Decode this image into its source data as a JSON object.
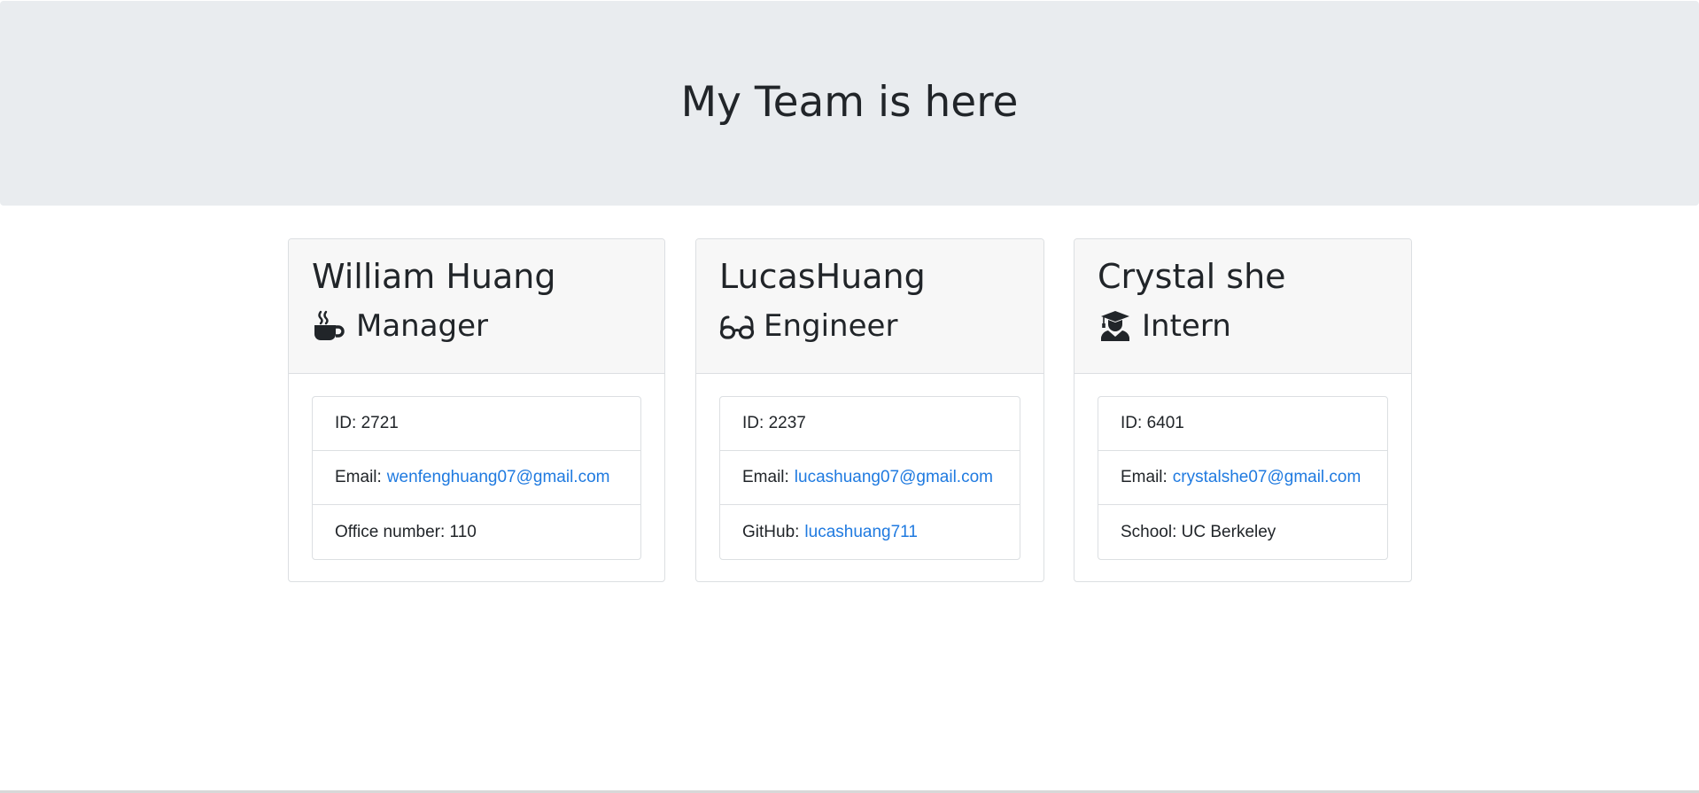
{
  "header": {
    "title": "My Team is here"
  },
  "employees": [
    {
      "name": "William Huang",
      "role": "Manager",
      "role_icon": "coffee-icon",
      "id_label": "ID:",
      "id": "2721",
      "email_label": "Email:",
      "email": "wenfenghuang07@gmail.com",
      "extra_label": "Office number:",
      "extra_value": "110"
    },
    {
      "name": "LucasHuang",
      "role": "Engineer",
      "role_icon": "glasses-icon",
      "id_label": "ID:",
      "id": "2237",
      "email_label": "Email:",
      "email": "lucashuang07@gmail.com",
      "extra_label": "GitHub:",
      "extra_value": "lucashuang711"
    },
    {
      "name": "Crystal she",
      "role": "Intern",
      "role_icon": "graduate-icon",
      "id_label": "ID:",
      "id": "6401",
      "email_label": "Email:",
      "email": "crystalshe07@gmail.com",
      "extra_label": "School:",
      "extra_value": "UC Berkeley"
    }
  ],
  "colors": {
    "jumbotron_bg": "#e9ecef",
    "card_header_bg": "#f7f7f7",
    "link": "#1f7ae0",
    "text": "#212529"
  }
}
